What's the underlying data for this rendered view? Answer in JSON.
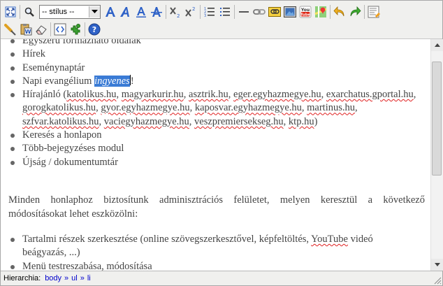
{
  "toolbar": {
    "style_select_value": "-- stílus --",
    "youtube_label": "You Tube"
  },
  "content": {
    "list1": [
      "Egyszerű formázható oldalak",
      "Hírek",
      "Eseménynaptár"
    ],
    "item4_before": "Napi evangélium ",
    "item4_selected": "ingyenes",
    "item4_after": "!",
    "hirajanlo_prefix": "Hírajánló (",
    "hirajanlo_sites": [
      "katolikus.hu",
      "magyarkurir.hu",
      "asztrik.hu",
      "eger.egyhazmegye.hu",
      "exarchatus.gportal.hu",
      "gorogkatolikus.hu",
      "gyor.egyhazmegye.hu",
      "kaposvar.egyhazmegye.hu",
      "martinus.hu",
      "szfvar.katolikus.hu",
      "vaciegyhazmegye.hu",
      "veszpremiersekseg.hu",
      "ktp.hu"
    ],
    "hirajanlo_suffix": ")",
    "list1_rest": [
      "Keresés a honlapon",
      "Több-bejegyzéses modul",
      "Újság / dokumentumtár"
    ],
    "para_line1": "Minden honlaphoz biztosítunk adminisztrációs felületet, melyen keresztül a következő",
    "para_line2": "módosításokat lehet eszközölni:",
    "list2_item1_a": "Tartalmi részek szerkesztése (online szövegszerkesztővel, képfeltöltés, ",
    "list2_item1_yt": "YouTube",
    "list2_item1_b": " videó",
    "list2_item1_c": "beágyazás, ...)",
    "list2_item2": "Menü testreszabása, módosítása"
  },
  "status": {
    "label": "Hierarchia:",
    "path": [
      "body",
      "ul",
      "li"
    ],
    "sep": "»"
  }
}
